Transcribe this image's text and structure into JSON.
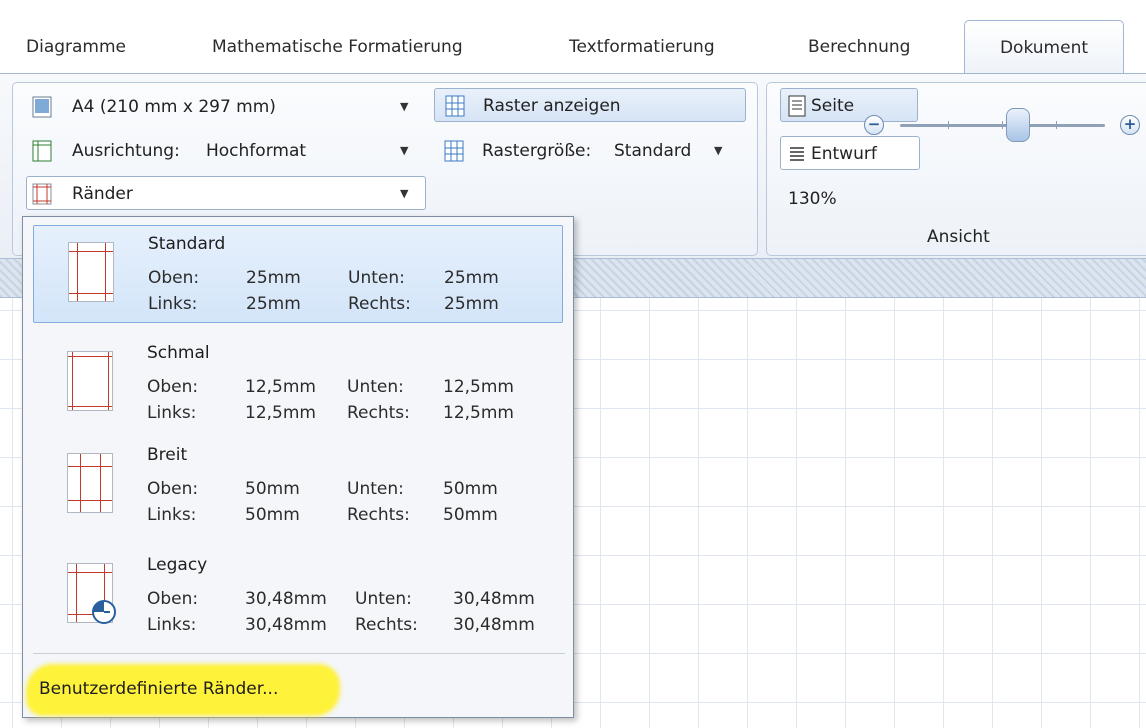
{
  "tabs": [
    {
      "label": "Diagramme",
      "active": false
    },
    {
      "label": "Mathematische Formatierung",
      "active": false
    },
    {
      "label": "Textformatierung",
      "active": false
    },
    {
      "label": "Berechnung",
      "active": false
    },
    {
      "label": "Dokument",
      "active": true
    }
  ],
  "page_group": {
    "paper_size": "A4 (210 mm x 297 mm)",
    "orientation_label": "Ausrichtung:",
    "orientation_value": "Hochformat",
    "margins_label": "Ränder"
  },
  "grid_group": {
    "show_grid": "Raster anzeigen",
    "grid_size_label": "Rastergröße:",
    "grid_size_value": "Standard"
  },
  "view_group": {
    "page": "Seite",
    "draft": "Entwurf",
    "zoom": "130%",
    "group_label": "Ansicht"
  },
  "margins_menu": {
    "options": [
      {
        "name": "Standard",
        "oben_label": "Oben:",
        "oben": "25mm",
        "unten_label": "Unten:",
        "unten": "25mm",
        "links_label": "Links:",
        "links": "25mm",
        "rechts_label": "Rechts:",
        "rechts": "25mm"
      },
      {
        "name": "Schmal",
        "oben_label": "Oben:",
        "oben": "12,5mm",
        "unten_label": "Unten:",
        "unten": "12,5mm",
        "links_label": "Links:",
        "links": "12,5mm",
        "rechts_label": "Rechts:",
        "rechts": "12,5mm"
      },
      {
        "name": "Breit",
        "oben_label": "Oben:",
        "oben": "50mm",
        "unten_label": "Unten:",
        "unten": "50mm",
        "links_label": "Links:",
        "links": "50mm",
        "rechts_label": "Rechts:",
        "rechts": "50mm"
      },
      {
        "name": "Legacy",
        "oben_label": "Oben:",
        "oben": "30,48mm",
        "unten_label": "Unten:",
        "unten": "30,48mm",
        "links_label": "Links:",
        "links": "30,48mm",
        "rechts_label": "Rechts:",
        "rechts": "30,48mm"
      }
    ],
    "custom": "Benutzerdefinierte Ränder..."
  },
  "colors": {
    "margin_line": "#c0392b",
    "highlight": "#fff23a",
    "selected_bg": "#d3e5f9"
  }
}
